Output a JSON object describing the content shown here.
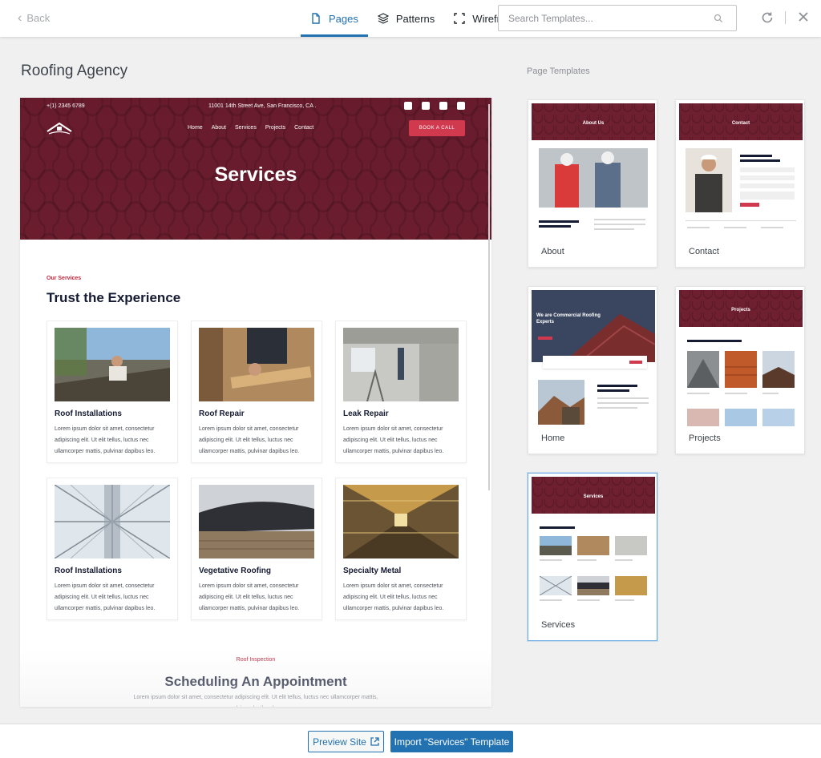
{
  "header": {
    "back_label": "Back",
    "tabs": [
      {
        "label": "Pages",
        "icon": "page-icon",
        "active": true
      },
      {
        "label": "Patterns",
        "icon": "layers-icon",
        "active": false
      },
      {
        "label": "Wireframe",
        "icon": "wireframe-icon",
        "active": false
      }
    ],
    "search_placeholder": "Search Templates...",
    "search_value": ""
  },
  "site": {
    "title": "Roofing Agency"
  },
  "preview": {
    "phone": "+(1) 2345 6789",
    "address": "11001 14th Street Ave, San Francisco, CA .",
    "socials": [
      "facebook-icon",
      "twitter-icon",
      "instagram-icon",
      "linkedin-icon"
    ],
    "nav": [
      "Home",
      "About",
      "Services",
      "Projects",
      "Contact"
    ],
    "cta": "BOOK A CALL",
    "hero_title": "Services",
    "eyebrow": "Our Services",
    "section_title": "Trust the Experience",
    "services": [
      {
        "name": "Roof Installations",
        "desc": "Lorem ipsum dolor sit amet, consectetur adipiscing elit. Ut elit tellus, luctus nec ullamcorper mattis, pulvinar dapibus leo."
      },
      {
        "name": "Roof Repair",
        "desc": "Lorem ipsum dolor sit amet, consectetur adipiscing elit. Ut elit tellus, luctus nec ullamcorper mattis, pulvinar dapibus leo."
      },
      {
        "name": "Leak Repair",
        "desc": "Lorem ipsum dolor sit amet, consectetur adipiscing elit. Ut elit tellus, luctus nec ullamcorper mattis, pulvinar dapibus leo."
      },
      {
        "name": "Roof Installations",
        "desc": "Lorem ipsum dolor sit amet, consectetur adipiscing elit. Ut elit tellus, luctus nec ullamcorper mattis, pulvinar dapibus leo."
      },
      {
        "name": "Vegetative Roofing",
        "desc": "Lorem ipsum dolor sit amet, consectetur adipiscing elit. Ut elit tellus, luctus nec ullamcorper mattis, pulvinar dapibus leo."
      },
      {
        "name": "Specialty Metal",
        "desc": "Lorem ipsum dolor sit amet, consectetur adipiscing elit. Ut elit tellus, luctus nec ullamcorper mattis, pulvinar dapibus leo."
      }
    ],
    "inspection_eyebrow": "Roof Inspection",
    "inspection_title": "Scheduling An Appointment",
    "inspection_desc": "Lorem ipsum dolor sit amet, consectetur adipiscing elit. Ut elit tellus, luctus nec ullamcorper mattis, pulvinar dapibus leo."
  },
  "templates": {
    "label": "Page Templates",
    "items": [
      {
        "name": "About",
        "banner": "About Us",
        "selected": false
      },
      {
        "name": "Contact",
        "banner": "Contact",
        "selected": false
      },
      {
        "name": "Home",
        "banner": "We are Commercial Roofing Experts",
        "selected": false
      },
      {
        "name": "Projects",
        "banner": "Projects",
        "selected": false
      },
      {
        "name": "Services",
        "banner": "Services",
        "selected": true
      }
    ]
  },
  "footer": {
    "preview_label": "Preview Site",
    "import_label": "Import \"Services\" Template"
  },
  "colors": {
    "accent": "#2271b1",
    "brand_maroon": "#6e1f30",
    "cta_red": "#d1394f",
    "selected_border": "#72aee6"
  }
}
